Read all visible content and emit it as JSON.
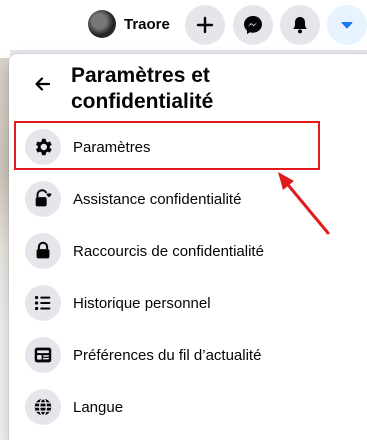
{
  "topbar": {
    "profile_name": "Traore",
    "buttons": [
      {
        "icon": "plus-icon"
      },
      {
        "icon": "messenger-icon"
      },
      {
        "icon": "bell-icon"
      },
      {
        "icon": "chevron-down-icon"
      }
    ]
  },
  "menu": {
    "title": "Paramètres et confidentialité",
    "items": [
      {
        "label": "Paramètres",
        "icon": "gear-icon"
      },
      {
        "label": "Assistance confidentialité",
        "icon": "lock-heart-icon"
      },
      {
        "label": "Raccourcis de confidentialité",
        "icon": "lock-icon"
      },
      {
        "label": "Historique personnel",
        "icon": "list-icon"
      },
      {
        "label": "Préférences du fil d’actualité",
        "icon": "feed-icon"
      },
      {
        "label": "Langue",
        "icon": "globe-icon"
      }
    ]
  },
  "colors": {
    "accent": "#1877f2",
    "annotation": "#e11b1b",
    "icon_bg": "#e4e6eb"
  }
}
